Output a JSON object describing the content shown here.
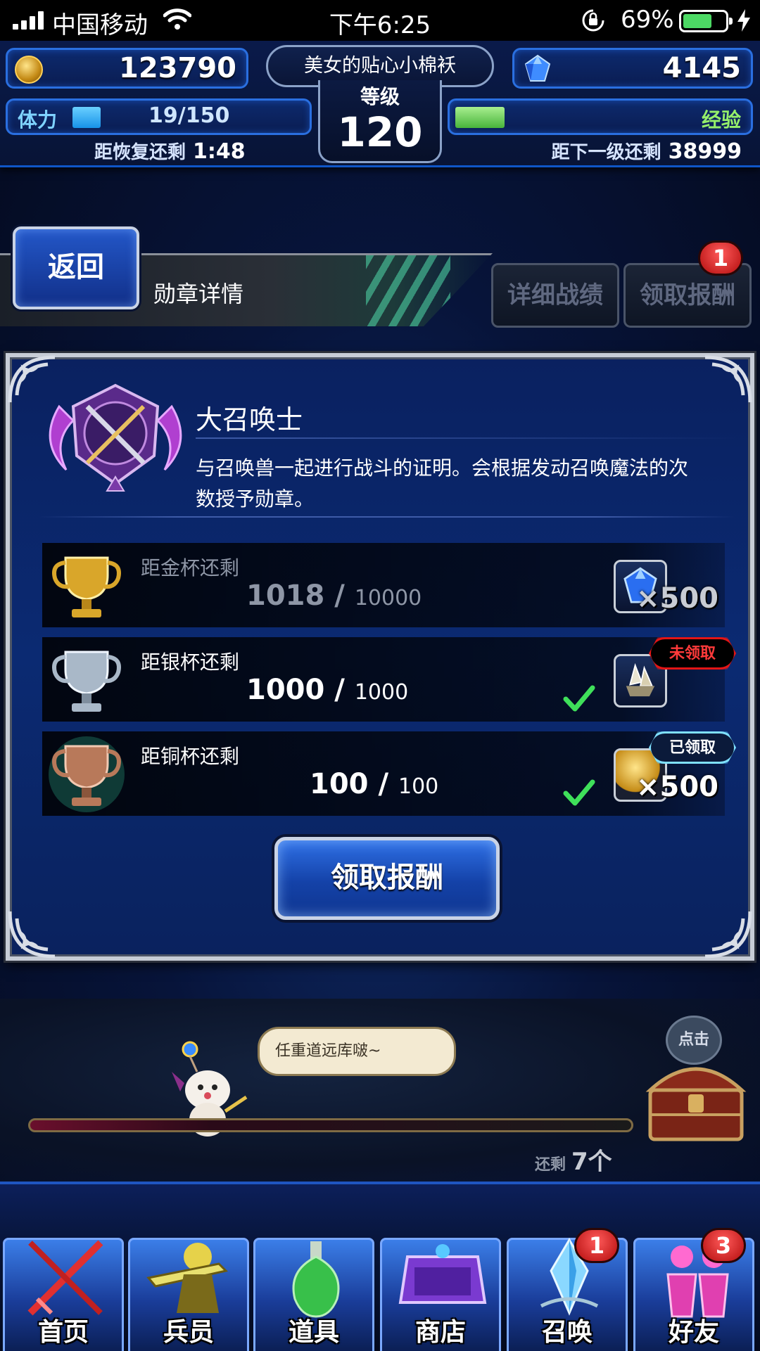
{
  "status_bar": {
    "carrier": "中国移动",
    "time": "下午6:25",
    "battery_pct": "69%",
    "battery_level": 0.69,
    "icons": [
      "signal-icon",
      "wifi-icon",
      "rotation-lock-icon",
      "battery-icon",
      "charging-icon"
    ]
  },
  "hud": {
    "gil": "123790",
    "gems": "4145",
    "player_name": "美女的贴心小棉袄",
    "level_label": "等级",
    "level": "120",
    "stamina_label": "体力",
    "stamina_value": "19/150",
    "stamina_fraction": 0.127,
    "exp_label": "经验",
    "exp_fraction": 0.2,
    "recover_label": "距恢复还剩",
    "recover_time": "1:48",
    "next_level_label": "距下一级还剩",
    "next_level_exp": "38999"
  },
  "header": {
    "back_label": "返回",
    "title": "勋章详情",
    "detail_label": "详细战绩",
    "claim_label": "领取报酬",
    "claim_badge": "1"
  },
  "medal": {
    "name": "大召唤士",
    "description": "与召唤兽一起进行战斗的证明。会根据发动召唤魔法的次数授予勋章。"
  },
  "cups": [
    {
      "label": "距金杯还剩",
      "current": "1018",
      "total": "10000",
      "reward_qty": "×500",
      "reward_icon": "gem-icon",
      "complete": false,
      "tag": ""
    },
    {
      "label": "距银杯还剩",
      "current": "1000",
      "total": "1000",
      "reward_qty": "",
      "reward_icon": "crystal-icon",
      "complete": true,
      "tag": "未领取"
    },
    {
      "label": "距铜杯还剩",
      "current": "100",
      "total": "100",
      "reward_qty": "×500",
      "reward_icon": "gil-coin-icon",
      "complete": true,
      "tag": "已领取"
    }
  ],
  "slash": "/",
  "claim_button": "领取报酬",
  "scene": {
    "speech": "任重道远库啵~",
    "tap_label": "点击",
    "remain_label": "还剩",
    "remain_count": "7个"
  },
  "nav": [
    {
      "label": "首页",
      "icon": "sword-icon"
    },
    {
      "label": "兵员",
      "icon": "warrior-icon"
    },
    {
      "label": "道具",
      "icon": "potion-icon"
    },
    {
      "label": "商店",
      "icon": "shop-icon"
    },
    {
      "label": "召唤",
      "icon": "crystal-icon",
      "badge": "1"
    },
    {
      "label": "好友",
      "icon": "friends-icon",
      "badge": "3"
    }
  ],
  "colors": {
    "accent_blue": "#2357c8",
    "frame_silver": "#c6ccd6",
    "badge_red": "#d41414",
    "check_green": "#3fe05a",
    "tag_red": "#e31515",
    "tag_blue": "#7fe0ff"
  }
}
